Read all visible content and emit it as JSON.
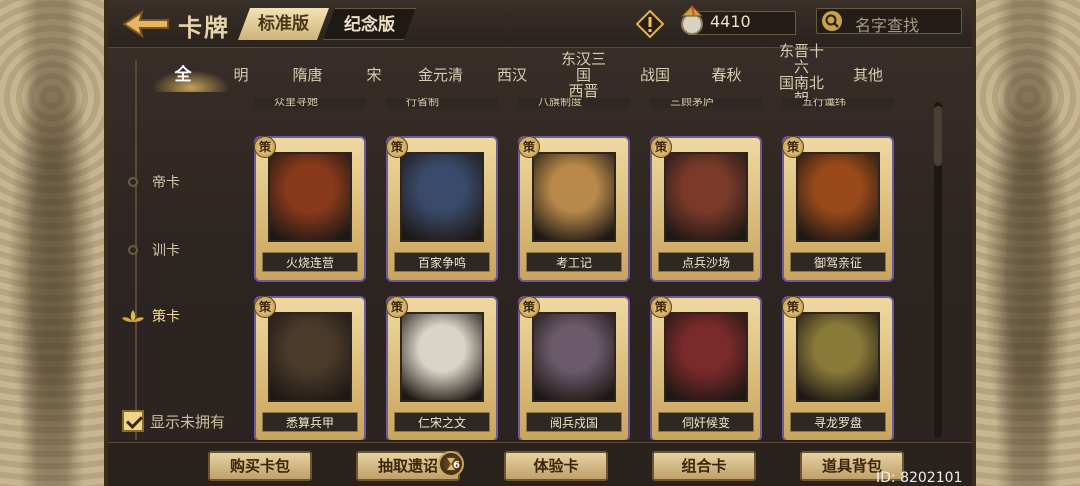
{
  "header": {
    "title": "卡牌",
    "edition_tabs": [
      {
        "label": "标准版",
        "active": true
      },
      {
        "label": "纪念版",
        "active": false
      }
    ],
    "coins": "4410",
    "search_placeholder": "名字查找"
  },
  "era_tabs": [
    "全",
    "明",
    "隋唐",
    "宋",
    "金元清",
    "西汉",
    "东汉三国西晋",
    "战国",
    "春秋",
    "东晋十六国南北朝",
    "其他"
  ],
  "era_tabs_display": [
    {
      "label": "全",
      "active": true
    },
    {
      "label": "明"
    },
    {
      "label": "隋唐"
    },
    {
      "label": "宋"
    },
    {
      "label": "金元清"
    },
    {
      "label": "西汉"
    },
    {
      "label": "东汉三国",
      "label2": "西晋"
    },
    {
      "label": "战国"
    },
    {
      "label": "春秋"
    },
    {
      "label": "东晋十六",
      "label2": "国南北朝"
    },
    {
      "label": "其他"
    }
  ],
  "categories": [
    {
      "label": "帝卡",
      "active": false
    },
    {
      "label": "训卡",
      "active": false
    },
    {
      "label": "策卡",
      "active": true
    }
  ],
  "partial_row": [
    "众里寻她",
    "行省制",
    "八旗制度",
    "三顾茅庐",
    "五行谶纬"
  ],
  "cards_row1": [
    {
      "name": "火烧连营",
      "badge": "策",
      "art": "#8a3a1c"
    },
    {
      "name": "百家争鸣",
      "badge": "策",
      "art": "#3a4a6a"
    },
    {
      "name": "考工记",
      "badge": "策",
      "art": "#b8894a"
    },
    {
      "name": "点兵沙场",
      "badge": "策",
      "art": "#7a3a2a"
    },
    {
      "name": "御驾亲征",
      "badge": "策",
      "art": "#9a4a1a"
    }
  ],
  "cards_row2": [
    {
      "name": "悉算兵甲",
      "badge": "策",
      "art": "#4a3a2a"
    },
    {
      "name": "仁宋之文",
      "badge": "策",
      "art": "#d9d4c6"
    },
    {
      "name": "阅兵戍国",
      "badge": "策",
      "art": "#6a5a6a"
    },
    {
      "name": "伺奸候变",
      "badge": "策",
      "art": "#7a2a2a"
    },
    {
      "name": "寻龙罗盘",
      "badge": "策",
      "art": "#8a7a3a"
    }
  ],
  "show_owned_label": "显示未拥有",
  "bottom_buttons": [
    "购买卡包",
    "抽取遗诏",
    "体验卡",
    "组合卡",
    "道具背包"
  ],
  "draw_badge_count": "6",
  "player_id": "ID: 8202101"
}
